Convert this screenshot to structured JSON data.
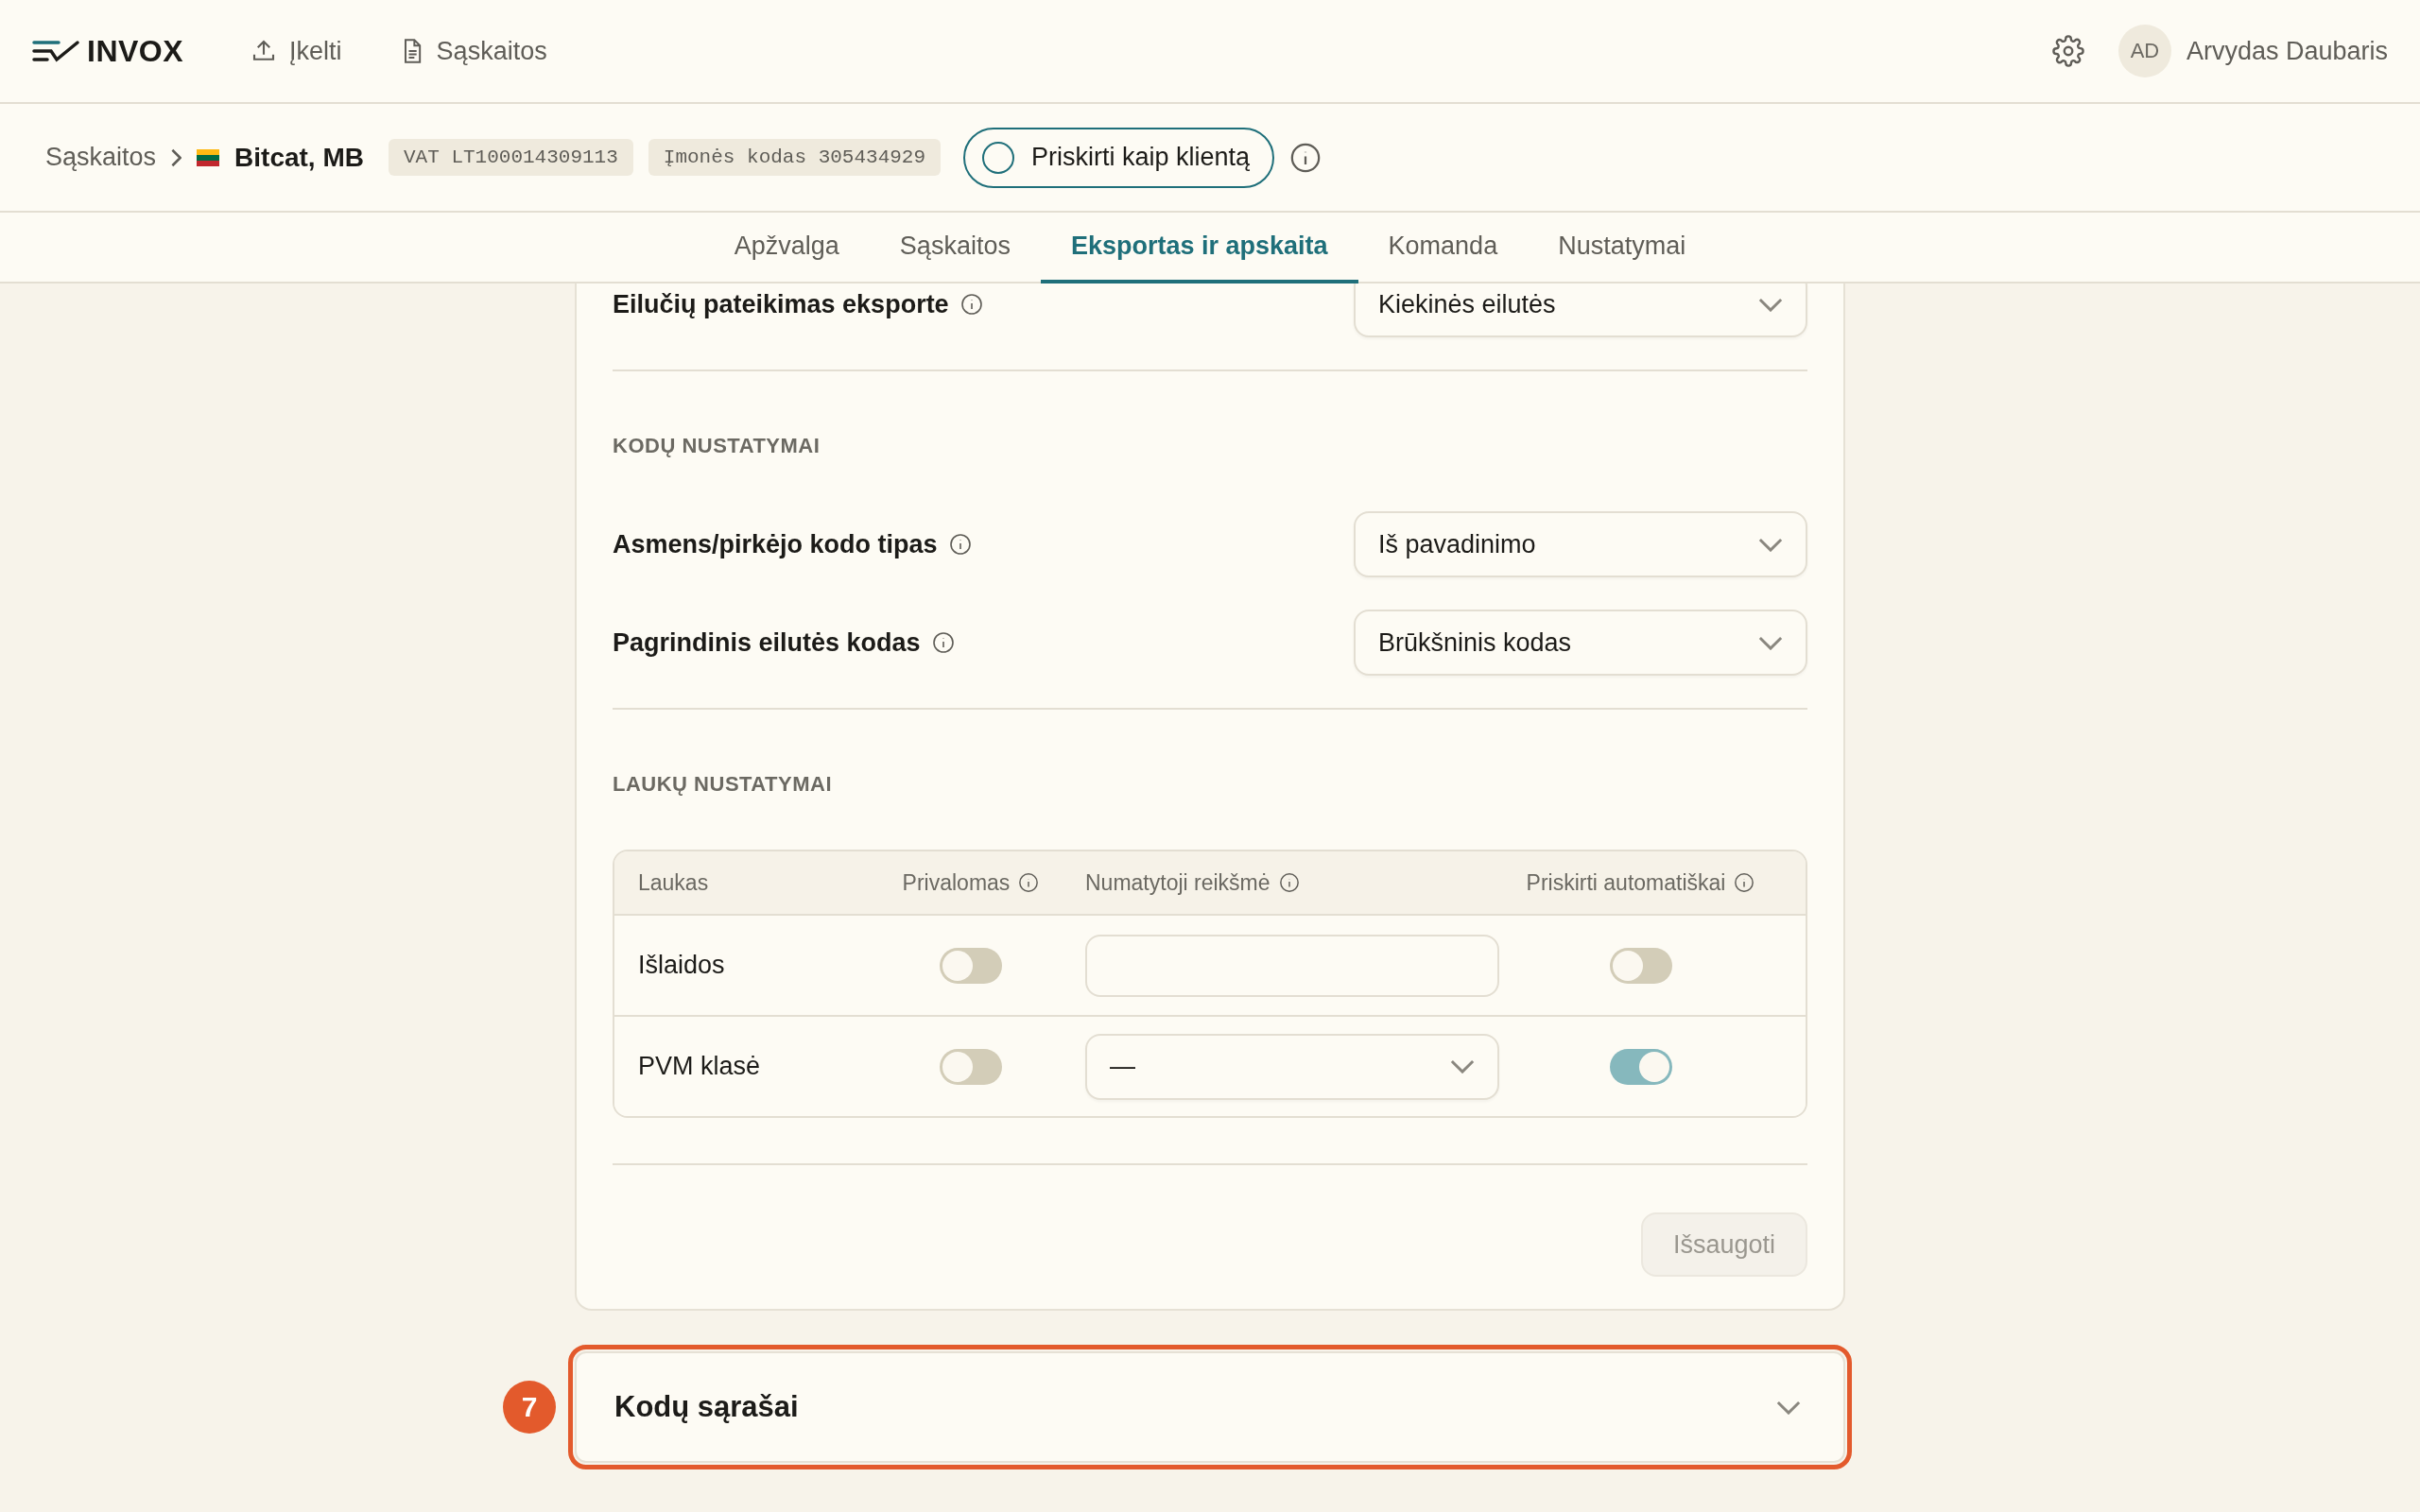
{
  "app": {
    "logo": "INVOX",
    "nav": [
      {
        "label": "Įkelti",
        "kind": "upload"
      },
      {
        "label": "Sąskaitos",
        "kind": "document"
      }
    ],
    "user": {
      "initials": "AD",
      "name": "Arvydas Daubaris"
    }
  },
  "breadcrumb": {
    "parent": "Sąskaitos",
    "company": "Bitcat, MB",
    "tags": [
      "VAT LT100014309113",
      "Įmonės kodas 305434929"
    ],
    "assign_button": {
      "label": "Priskirti kaip klientą",
      "checked": false
    }
  },
  "tabs": [
    {
      "label": "Apžvalga",
      "selected": false
    },
    {
      "label": "Sąskaitos",
      "selected": false
    },
    {
      "label": "Eksportas ir apskaita",
      "selected": true
    },
    {
      "label": "Komanda",
      "selected": false
    },
    {
      "label": "Nustatymai",
      "selected": false
    }
  ],
  "export_rows": [
    {
      "label": "Eilučių pateikimas eksporte",
      "value": "Kiekinės eilutės"
    }
  ],
  "code_settings": {
    "heading": "KODŲ NUSTATYMAI",
    "rows": [
      {
        "label": "Asmens/pirkėjo kodo tipas",
        "value": "Iš pavadinimo"
      },
      {
        "label": "Pagrindinis eilutės kodas",
        "value": "Brūkšninis kodas"
      }
    ]
  },
  "field_settings": {
    "heading": "LAUKŲ NUSTATYMAI",
    "columns": [
      {
        "label": "Laukas",
        "info": false
      },
      {
        "label": "Privalomas",
        "info": true
      },
      {
        "label": "Numatytoji reikšmė",
        "info": true
      },
      {
        "label": "Priskirti automatiškai",
        "info": true
      }
    ],
    "rows": [
      {
        "field": "Išlaidos",
        "required": false,
        "default": {
          "kind": "input"
        },
        "auto_assign": false
      },
      {
        "field": "PVM klasė",
        "required": false,
        "default": {
          "kind": "select",
          "value": "—"
        },
        "auto_assign": true
      }
    ]
  },
  "save_button": {
    "label": "Išsaugoti",
    "disabled": true
  },
  "accordion": {
    "title": "Kodų sąrašai",
    "expanded": false,
    "highlighted": true,
    "step": "7"
  }
}
